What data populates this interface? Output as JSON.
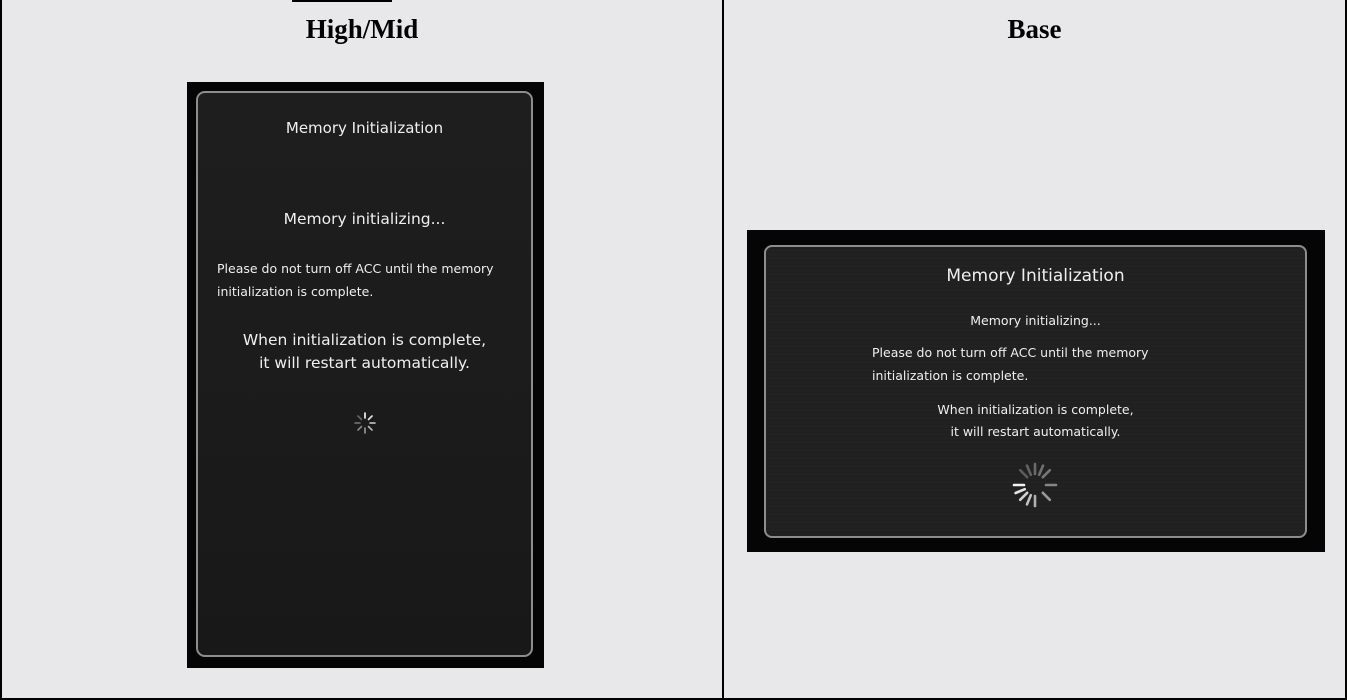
{
  "columns": {
    "left_header": "High/Mid",
    "right_header": "Base"
  },
  "high_mid_screen": {
    "title": "Memory Initialization",
    "status": "Memory initializing...",
    "warning_line1": "Please do not turn off ACC until the memory",
    "warning_line2": "initialization is complete.",
    "restart_line1": "When initialization is complete,",
    "restart_line2": "it will restart automatically.",
    "spinner_icon": "loading-spinner-icon"
  },
  "base_screen": {
    "title": "Memory Initialization",
    "status": "Memory initializing...",
    "warning_line1": "Please do not turn off ACC until the memory",
    "warning_line2": "initialization is complete.",
    "restart_line1": "When initialization is complete,",
    "restart_line2": "it will restart automatically.",
    "spinner_icon": "loading-spinner-icon"
  },
  "colors": {
    "page_bg": "#e8e8ea",
    "screen_bg": "#050505",
    "panel_border": "#8d8d8d",
    "text": "#efefef"
  }
}
